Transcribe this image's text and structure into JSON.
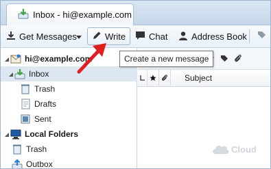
{
  "tab": {
    "label": "Inbox - hi@example.com",
    "icon": "inbox-download-icon"
  },
  "toolbar": {
    "get_messages": "Get Messages",
    "write": "Write",
    "chat": "Chat",
    "address_book": "Address Book"
  },
  "tooltip": {
    "text": "Create a new message"
  },
  "folders": {
    "account": "hi@example.com",
    "inbox": "Inbox",
    "trash": "Trash",
    "drafts": "Drafts",
    "sent": "Sent",
    "local_folders": "Local Folders",
    "local_trash": "Trash",
    "outbox": "Outbox"
  },
  "message_list": {
    "subject_header": "Subject"
  },
  "watermark": {
    "text": "Cloud"
  },
  "colors": {
    "accent": "#2b7cd3",
    "arrow": "#e02020",
    "selection": "#dde7f1",
    "inbox_green": "#3aa53a"
  }
}
